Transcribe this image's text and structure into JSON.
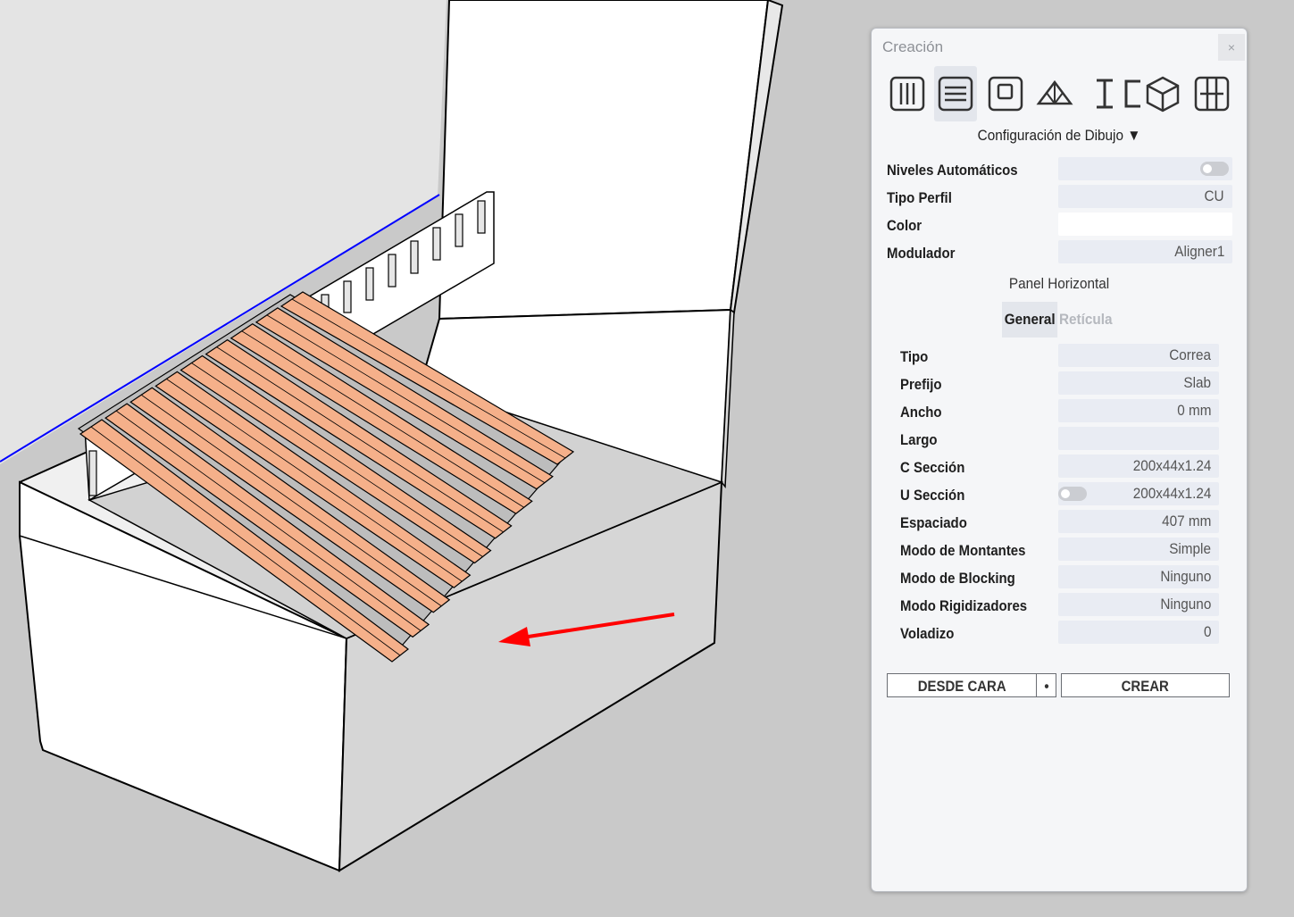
{
  "panel": {
    "title": "Creación",
    "close": "×",
    "toolbar": [
      {
        "icon": "studs-icon"
      },
      {
        "icon": "horizontal-panel-icon"
      },
      {
        "icon": "window-frame-icon"
      },
      {
        "icon": "roof-truss-icon"
      },
      {
        "icon": "i-profile-icon"
      },
      {
        "icon": "c-profile-icon"
      },
      {
        "icon": "box-3d-icon"
      },
      {
        "icon": "grid-frame-icon"
      }
    ],
    "config_title": "Configuración de Dibujo ▼",
    "config": {
      "niveles_label": "Niveles Automáticos",
      "tipo_perfil_label": "Tipo Perfil",
      "tipo_perfil_value": "CU",
      "color_label": "Color",
      "modulador_label": "Modulador",
      "modulador_value": "Aligner1"
    },
    "panel_title": "Panel Horizontal",
    "tabs": {
      "general": "General",
      "reticula": "Retícula"
    },
    "fields": [
      {
        "label": "Tipo",
        "value": "Correa"
      },
      {
        "label": "Prefijo",
        "value": "Slab"
      },
      {
        "label": "Ancho",
        "value": "0 mm"
      },
      {
        "label": "Largo",
        "value": ""
      },
      {
        "label": "C Sección",
        "value": "200x44x1.24"
      },
      {
        "label": "U Sección",
        "value": "200x44x1.24"
      },
      {
        "label": "Espaciado",
        "value": "407 mm"
      },
      {
        "label": "Modo de Montantes",
        "value": "Simple"
      },
      {
        "label": "Modo de Blocking",
        "value": "Ninguno"
      },
      {
        "label": "Modo Rigidizadores",
        "value": "Ninguno"
      },
      {
        "label": "Voladizo",
        "value": "0"
      }
    ],
    "buttons": {
      "desde_cara": "DESDE CARA",
      "dot": "•",
      "crear": "CREAR"
    }
  },
  "colors": {
    "joist": "#f5b08a",
    "axis_blue": "#0000ff",
    "arrow_red": "#ff0000"
  }
}
